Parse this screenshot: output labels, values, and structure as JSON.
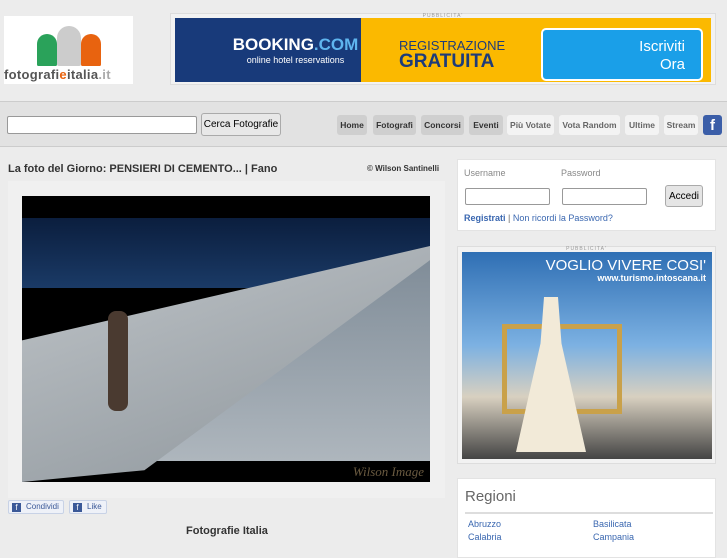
{
  "logo": {
    "text_a": "fotografi",
    "text_b": "e",
    "text_c": "italia",
    "text_d": ".it"
  },
  "ad_top": {
    "label": "PUBBLICITA'",
    "brand_a": "BOOKING",
    "brand_b": ".COM",
    "tagline": "online hotel reservations",
    "line1": "REGISTRAZIONE",
    "line2": "GRATUITA",
    "cta1": "Iscriviti",
    "cta2": "Ora"
  },
  "search": {
    "value": "",
    "button": "Cerca Fotografie"
  },
  "nav": [
    {
      "label": "Home"
    },
    {
      "label": "Fotografi"
    },
    {
      "label": "Concorsi"
    },
    {
      "label": "Eventi"
    },
    {
      "label": "Più Votate"
    },
    {
      "label": "Vota Random"
    },
    {
      "label": "Ultime"
    },
    {
      "label": "Stream"
    }
  ],
  "photo": {
    "title": "La foto del Giorno: PENSIERI DI CEMENTO... | Fano",
    "credit": "© Wilson Santinelli",
    "watermark": "Wilson Image"
  },
  "share": {
    "condividi": "Condividi",
    "like": "Like"
  },
  "section_title": "Fotografie Italia",
  "login": {
    "username_label": "Username",
    "password_label": "Password",
    "button": "Accedi",
    "register": "Registrati",
    "sep": " | ",
    "forgot": "Non ricordi la Password?"
  },
  "ad_side": {
    "label": "PUBBLICITA'",
    "headline": "VOGLIO VIVERE COSI'",
    "url": "www.turismo.intoscana.it"
  },
  "regioni": {
    "title": "Regioni",
    "items": [
      "Abruzzo",
      "Basilicata",
      "Calabria",
      "Campania"
    ]
  },
  "colors": {
    "link": "#3a67b0",
    "facebook": "#3b5998",
    "booking_blue": "#183a7a",
    "booking_yellow": "#fbb900"
  }
}
